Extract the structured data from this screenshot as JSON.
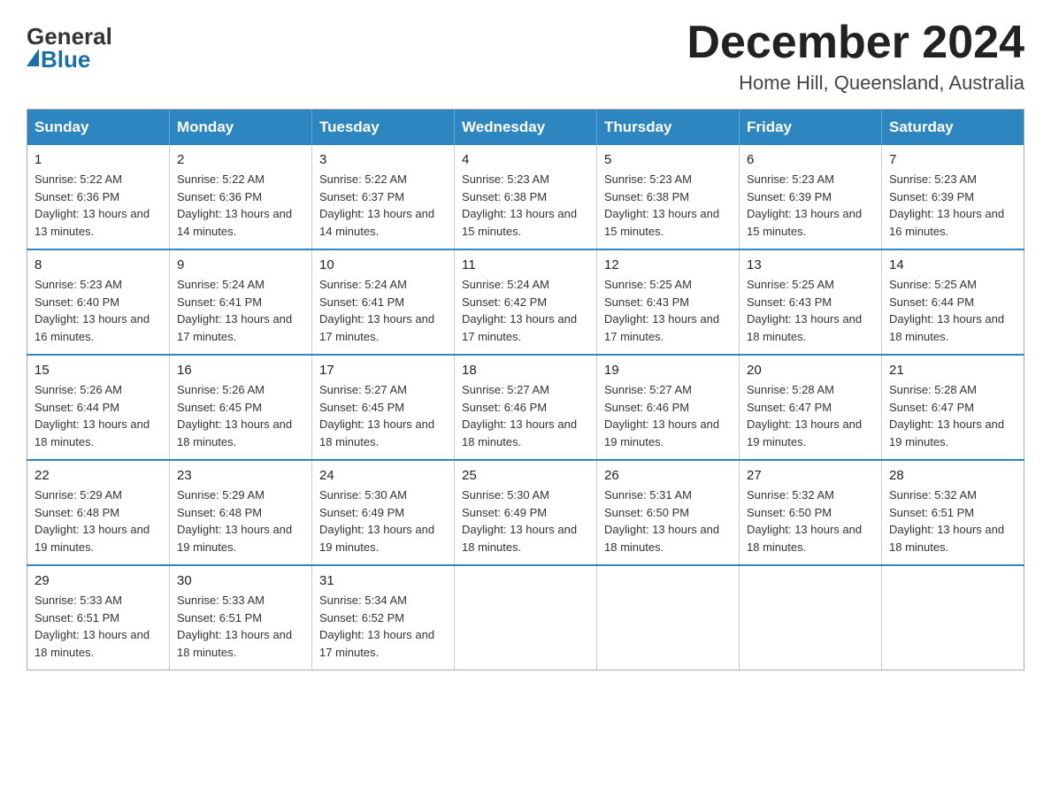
{
  "logo": {
    "general": "General",
    "blue": "Blue"
  },
  "title": "December 2024",
  "location": "Home Hill, Queensland, Australia",
  "days_of_week": [
    "Sunday",
    "Monday",
    "Tuesday",
    "Wednesday",
    "Thursday",
    "Friday",
    "Saturday"
  ],
  "weeks": [
    [
      {
        "day": "1",
        "sunrise": "5:22 AM",
        "sunset": "6:36 PM",
        "daylight": "13 hours and 13 minutes."
      },
      {
        "day": "2",
        "sunrise": "5:22 AM",
        "sunset": "6:36 PM",
        "daylight": "13 hours and 14 minutes."
      },
      {
        "day": "3",
        "sunrise": "5:22 AM",
        "sunset": "6:37 PM",
        "daylight": "13 hours and 14 minutes."
      },
      {
        "day": "4",
        "sunrise": "5:23 AM",
        "sunset": "6:38 PM",
        "daylight": "13 hours and 15 minutes."
      },
      {
        "day": "5",
        "sunrise": "5:23 AM",
        "sunset": "6:38 PM",
        "daylight": "13 hours and 15 minutes."
      },
      {
        "day": "6",
        "sunrise": "5:23 AM",
        "sunset": "6:39 PM",
        "daylight": "13 hours and 15 minutes."
      },
      {
        "day": "7",
        "sunrise": "5:23 AM",
        "sunset": "6:39 PM",
        "daylight": "13 hours and 16 minutes."
      }
    ],
    [
      {
        "day": "8",
        "sunrise": "5:23 AM",
        "sunset": "6:40 PM",
        "daylight": "13 hours and 16 minutes."
      },
      {
        "day": "9",
        "sunrise": "5:24 AM",
        "sunset": "6:41 PM",
        "daylight": "13 hours and 17 minutes."
      },
      {
        "day": "10",
        "sunrise": "5:24 AM",
        "sunset": "6:41 PM",
        "daylight": "13 hours and 17 minutes."
      },
      {
        "day": "11",
        "sunrise": "5:24 AM",
        "sunset": "6:42 PM",
        "daylight": "13 hours and 17 minutes."
      },
      {
        "day": "12",
        "sunrise": "5:25 AM",
        "sunset": "6:43 PM",
        "daylight": "13 hours and 17 minutes."
      },
      {
        "day": "13",
        "sunrise": "5:25 AM",
        "sunset": "6:43 PM",
        "daylight": "13 hours and 18 minutes."
      },
      {
        "day": "14",
        "sunrise": "5:25 AM",
        "sunset": "6:44 PM",
        "daylight": "13 hours and 18 minutes."
      }
    ],
    [
      {
        "day": "15",
        "sunrise": "5:26 AM",
        "sunset": "6:44 PM",
        "daylight": "13 hours and 18 minutes."
      },
      {
        "day": "16",
        "sunrise": "5:26 AM",
        "sunset": "6:45 PM",
        "daylight": "13 hours and 18 minutes."
      },
      {
        "day": "17",
        "sunrise": "5:27 AM",
        "sunset": "6:45 PM",
        "daylight": "13 hours and 18 minutes."
      },
      {
        "day": "18",
        "sunrise": "5:27 AM",
        "sunset": "6:46 PM",
        "daylight": "13 hours and 18 minutes."
      },
      {
        "day": "19",
        "sunrise": "5:27 AM",
        "sunset": "6:46 PM",
        "daylight": "13 hours and 19 minutes."
      },
      {
        "day": "20",
        "sunrise": "5:28 AM",
        "sunset": "6:47 PM",
        "daylight": "13 hours and 19 minutes."
      },
      {
        "day": "21",
        "sunrise": "5:28 AM",
        "sunset": "6:47 PM",
        "daylight": "13 hours and 19 minutes."
      }
    ],
    [
      {
        "day": "22",
        "sunrise": "5:29 AM",
        "sunset": "6:48 PM",
        "daylight": "13 hours and 19 minutes."
      },
      {
        "day": "23",
        "sunrise": "5:29 AM",
        "sunset": "6:48 PM",
        "daylight": "13 hours and 19 minutes."
      },
      {
        "day": "24",
        "sunrise": "5:30 AM",
        "sunset": "6:49 PM",
        "daylight": "13 hours and 19 minutes."
      },
      {
        "day": "25",
        "sunrise": "5:30 AM",
        "sunset": "6:49 PM",
        "daylight": "13 hours and 18 minutes."
      },
      {
        "day": "26",
        "sunrise": "5:31 AM",
        "sunset": "6:50 PM",
        "daylight": "13 hours and 18 minutes."
      },
      {
        "day": "27",
        "sunrise": "5:32 AM",
        "sunset": "6:50 PM",
        "daylight": "13 hours and 18 minutes."
      },
      {
        "day": "28",
        "sunrise": "5:32 AM",
        "sunset": "6:51 PM",
        "daylight": "13 hours and 18 minutes."
      }
    ],
    [
      {
        "day": "29",
        "sunrise": "5:33 AM",
        "sunset": "6:51 PM",
        "daylight": "13 hours and 18 minutes."
      },
      {
        "day": "30",
        "sunrise": "5:33 AM",
        "sunset": "6:51 PM",
        "daylight": "13 hours and 18 minutes."
      },
      {
        "day": "31",
        "sunrise": "5:34 AM",
        "sunset": "6:52 PM",
        "daylight": "13 hours and 17 minutes."
      },
      null,
      null,
      null,
      null
    ]
  ]
}
